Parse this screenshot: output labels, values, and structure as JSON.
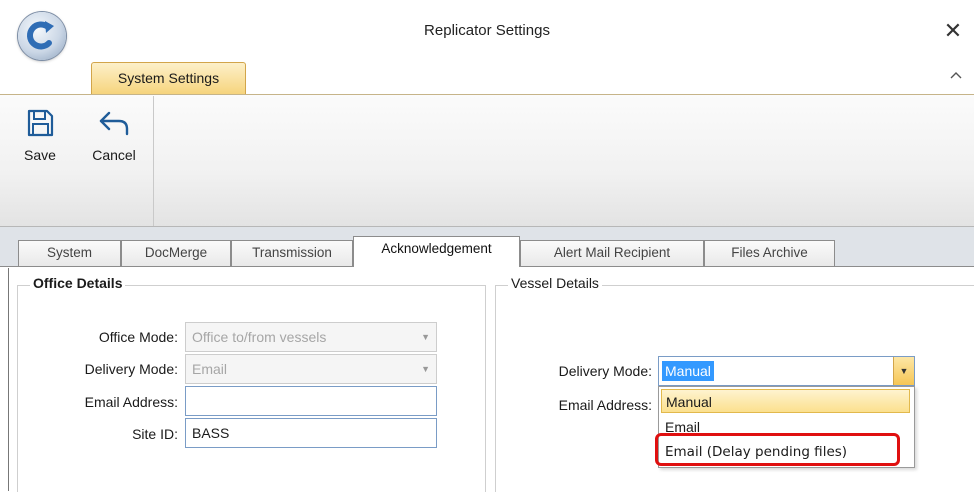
{
  "window": {
    "title": "Replicator Settings",
    "close_glyph": "✕"
  },
  "ribbon": {
    "tab_label": "System Settings",
    "collapse_icon": "chevron-up-icon",
    "buttons": [
      {
        "label": "Save",
        "icon": "floppy-disk-icon"
      },
      {
        "label": "Cancel",
        "icon": "undo-arrow-icon"
      }
    ]
  },
  "tabs": [
    {
      "label": "System"
    },
    {
      "label": "DocMerge"
    },
    {
      "label": "Transmission"
    },
    {
      "label": "Acknowledgement",
      "active": true
    },
    {
      "label": "Alert Mail Recipient"
    },
    {
      "label": "Files Archive"
    }
  ],
  "office": {
    "title": "Office Details",
    "office_mode_label": "Office Mode:",
    "office_mode_value": "Office to/from vessels",
    "delivery_mode_label": "Delivery Mode:",
    "delivery_mode_value": "Email",
    "email_label": "Email Address:",
    "email_value": "",
    "site_id_label": "Site ID:",
    "site_id_value": "BASS"
  },
  "vessel": {
    "title": "Vessel Details",
    "delivery_mode_label": "Delivery Mode:",
    "delivery_mode_value": "Manual",
    "email_label": "Email Address:",
    "options": [
      "Manual",
      "Email",
      "Email (Delay pending files)"
    ],
    "hovered_option": "Manual",
    "highlighted_option": "Email (Delay pending files)"
  },
  "colors": {
    "ribbon_tab": "#f6d47d",
    "selection": "#3399ff",
    "annotation": "#e01010"
  }
}
